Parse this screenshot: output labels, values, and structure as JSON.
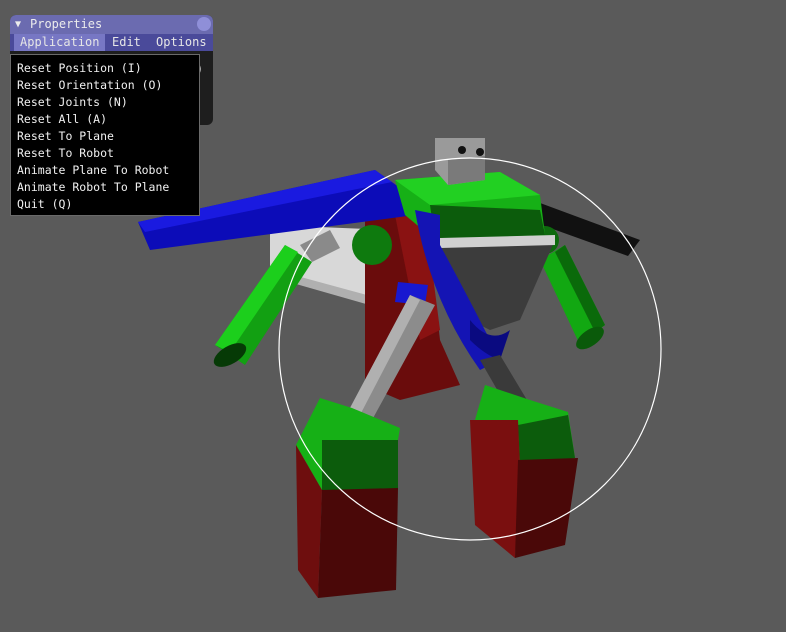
{
  "window": {
    "title": "Properties",
    "collapse_glyph": "▼",
    "partial_value": ")",
    "colors": {
      "title_bar": "#6b6bb0",
      "menu_bar": "#4a4a9a",
      "active_menu": "#7777c4",
      "background": "#1e1e1e"
    }
  },
  "menubar": {
    "items": [
      {
        "label": "Application",
        "active": true
      },
      {
        "label": "Edit",
        "active": false
      },
      {
        "label": "Options",
        "active": false
      }
    ]
  },
  "application_menu": {
    "items": [
      {
        "label": "Reset Position (I)"
      },
      {
        "label": "Reset Orientation (O)"
      },
      {
        "label": "Reset Joints (N)"
      },
      {
        "label": "Reset All (A)"
      },
      {
        "label": "Reset To Plane"
      },
      {
        "label": "Reset To Robot"
      },
      {
        "label": "Animate Plane To Robot"
      },
      {
        "label": "Animate Robot To Plane"
      },
      {
        "label": "Quit (Q)"
      }
    ]
  },
  "scene": {
    "background": "#5a5a5a",
    "colors": {
      "green": "#18b818",
      "dark_green": "#0e5a0e",
      "blue": "#1010c8",
      "red": "#7a1010",
      "grey": "#9a9a9a",
      "dark_grey": "#3c3c3c",
      "white": "#e0e0e0"
    }
  }
}
